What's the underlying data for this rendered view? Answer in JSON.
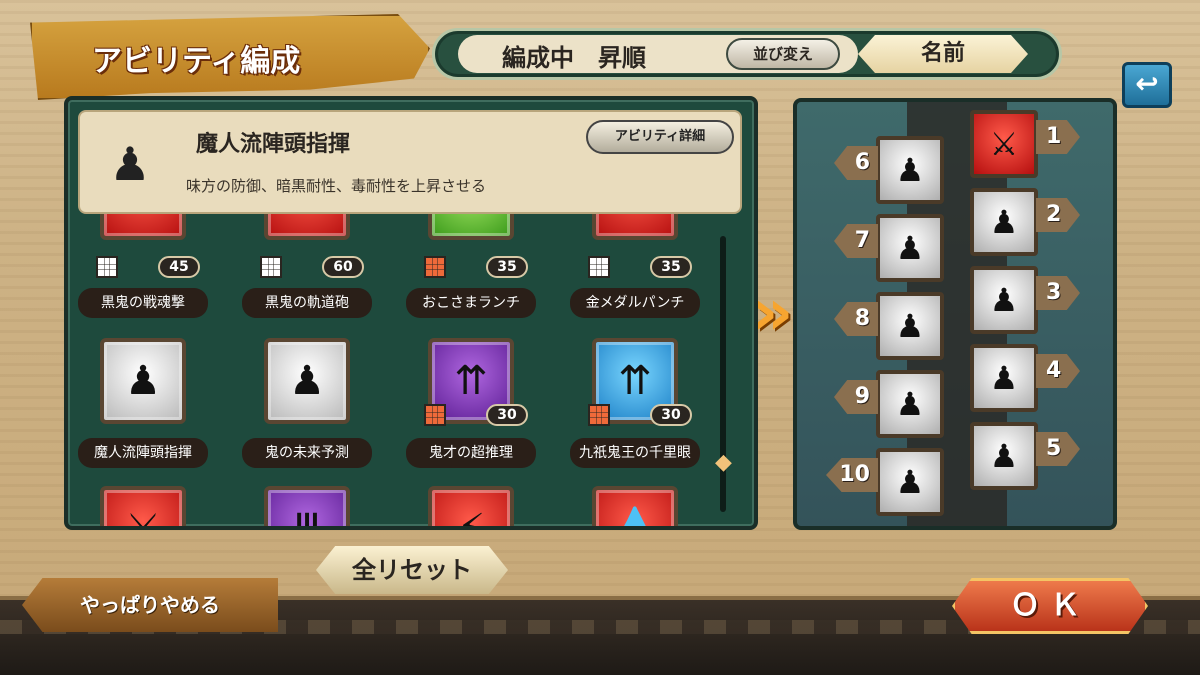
{
  "header": {
    "title": "アビリティ編成",
    "sort_label": "編成中　昇順",
    "sort_change_label": "並び変え",
    "sort_key_label": "名前",
    "back_icon": "back-arrow-icon"
  },
  "detail": {
    "icon": "demon-figure-icon",
    "name": "魔人流陣頭指揮",
    "description": "味方の防御、暗黒耐性、毒耐性を上昇させる",
    "detail_button": "アビリティ詳細"
  },
  "abilities": [
    {
      "name": "黒鬼の戦魂撃",
      "cost": "45",
      "color": "red",
      "icon": "sword-icon",
      "slot_mark": "white"
    },
    {
      "name": "黒鬼の軌道砲",
      "cost": "60",
      "color": "red",
      "icon": "sword-icon",
      "slot_mark": "white"
    },
    {
      "name": "おこさまランチ",
      "cost": "35",
      "color": "green",
      "icon": "heart-icon",
      "slot_mark": "orange"
    },
    {
      "name": "金メダルパンチ",
      "cost": "35",
      "color": "red",
      "icon": "sword-icon",
      "slot_mark": "white"
    },
    {
      "name": "魔人流陣頭指揮",
      "cost": "",
      "color": "gray",
      "icon": "demon-figure-icon",
      "slot_mark": ""
    },
    {
      "name": "鬼の未来予測",
      "cost": "",
      "color": "gray",
      "icon": "demon-figure-icon",
      "slot_mark": ""
    },
    {
      "name": "鬼才の超推理",
      "cost": "30",
      "color": "purple",
      "icon": "triple-up-arrow-icon",
      "slot_mark": "orange"
    },
    {
      "name": "九祇鬼王の千里眼",
      "cost": "30",
      "color": "blue",
      "icon": "triple-up-arrow-icon",
      "slot_mark": "orange"
    }
  ],
  "slots": [
    {
      "num": "1",
      "color": "red",
      "icon": "sword-icon"
    },
    {
      "num": "2",
      "color": "gray",
      "icon": "demon-figure-icon"
    },
    {
      "num": "3",
      "color": "gray",
      "icon": "demon-figure-icon"
    },
    {
      "num": "4",
      "color": "gray",
      "icon": "demon-figure-icon"
    },
    {
      "num": "5",
      "color": "gray",
      "icon": "demon-figure-icon"
    },
    {
      "num": "6",
      "color": "gray",
      "icon": "demon-figure-icon"
    },
    {
      "num": "7",
      "color": "gray",
      "icon": "demon-figure-icon"
    },
    {
      "num": "8",
      "color": "gray",
      "icon": "demon-figure-icon"
    },
    {
      "num": "9",
      "color": "gray",
      "icon": "demon-figure-icon"
    },
    {
      "num": "10",
      "color": "gray",
      "icon": "demon-figure-icon"
    }
  ],
  "footer": {
    "reset_label": "全リセット",
    "cancel_label": "やっぱりやめる",
    "ok_label": "ＯＫ"
  }
}
